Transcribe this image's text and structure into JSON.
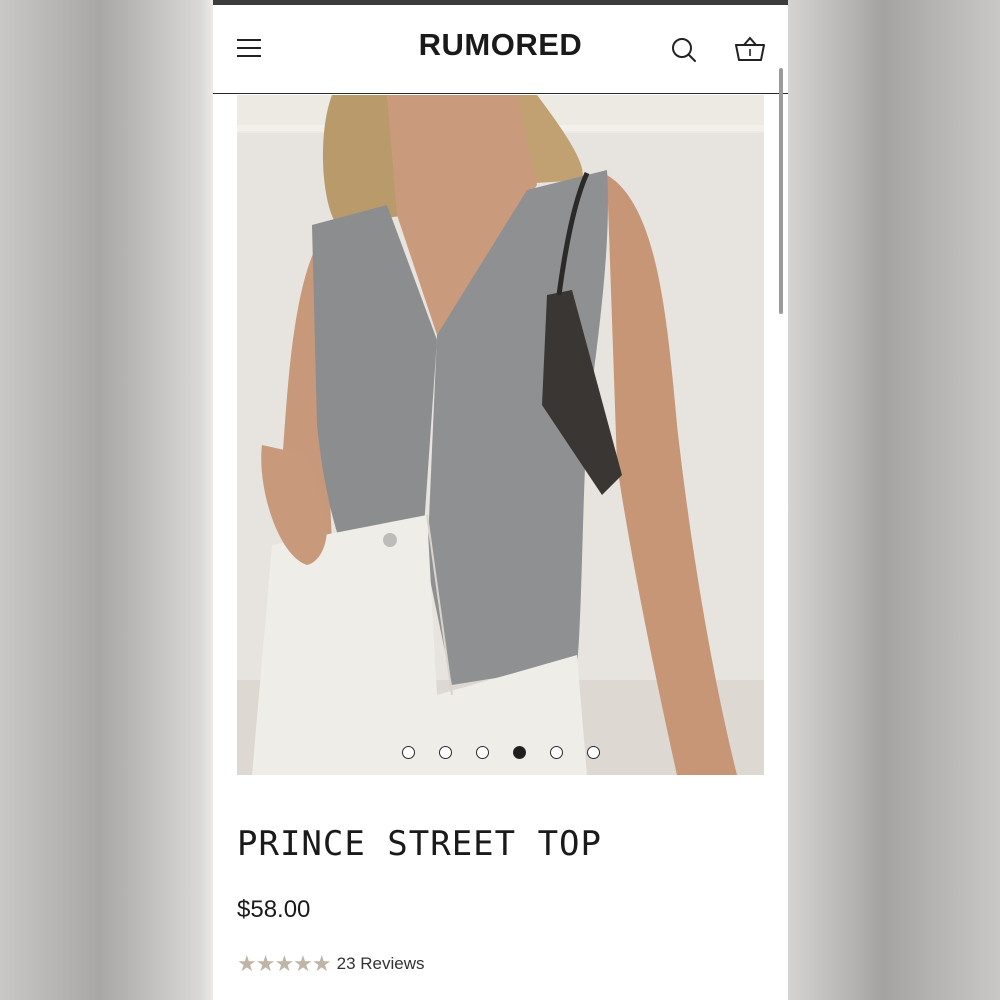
{
  "header": {
    "brand": "RUMORED",
    "menu_icon": "hamburger-menu-icon",
    "search_icon": "search-icon",
    "cart_icon": "basket-icon"
  },
  "gallery": {
    "image_count": 6,
    "active_index": 3
  },
  "product": {
    "title": "PRINCE STREET TOP",
    "price": "$58.00",
    "rating_stars": 5,
    "reviews_label": "23 Reviews"
  },
  "colors": {
    "star": "#bfb5a6",
    "text": "#1a1a1a"
  }
}
